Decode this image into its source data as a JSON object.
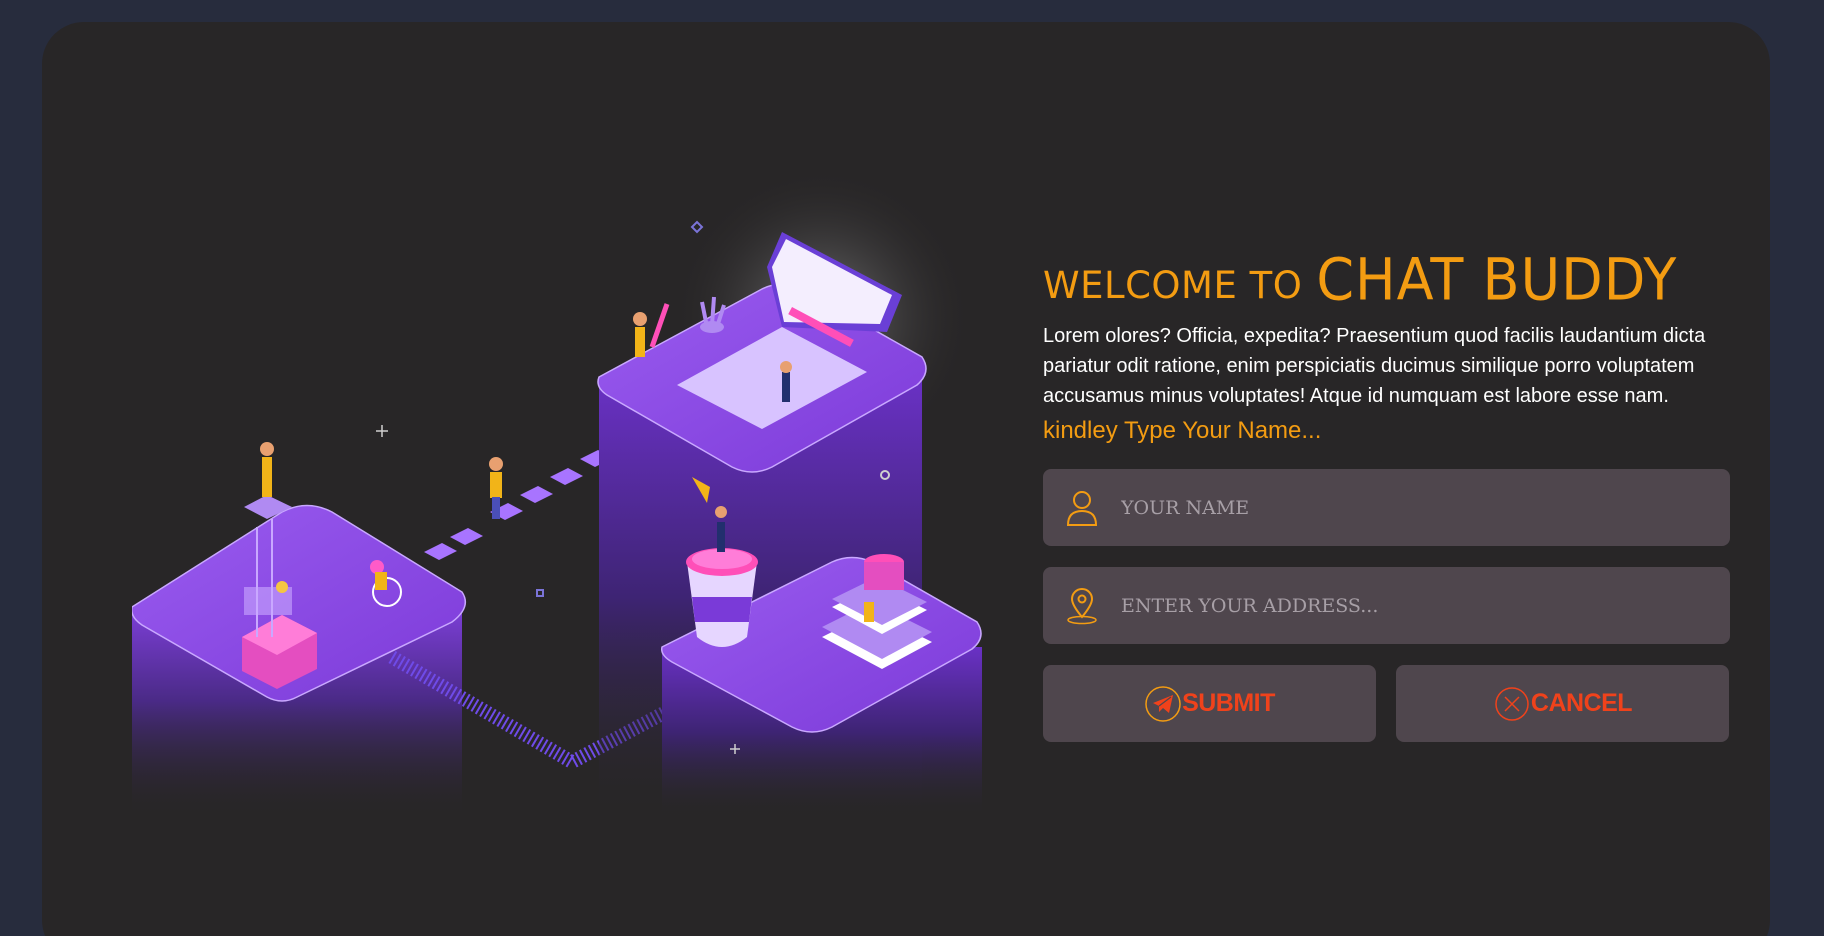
{
  "welcome": {
    "prefix": "WELCOME TO",
    "brand": "CHAT BUDDY"
  },
  "description": "Lorem olores? Officia, expedita? Praesentium quod facilis laudantium dicta pariatur odit ratione, enim perspiciatis ducimus similique porro voluptatem accusamus minus voluptates! Atque id numquam est labore esse nam.",
  "prompt": "kindley Type Your Name...",
  "name_field": {
    "placeholder": "YOUR NAME",
    "value": "",
    "icon": "user-icon"
  },
  "address_field": {
    "placeholder": "ENTER YOUR ADDRESS...",
    "value": "",
    "icon": "location-pin-icon"
  },
  "submit": {
    "label": "SUBMIT",
    "icon": "send-icon"
  },
  "cancel": {
    "label": "CANCEL",
    "icon": "close-circle-icon"
  },
  "colors": {
    "accent": "#f39c12",
    "button_text": "#f0421b",
    "field_bg": "#4f464d",
    "card_bg": "#282627",
    "page_bg": "#272c3d"
  },
  "illustration": {
    "name": "isometric-teamwork-illustration"
  }
}
